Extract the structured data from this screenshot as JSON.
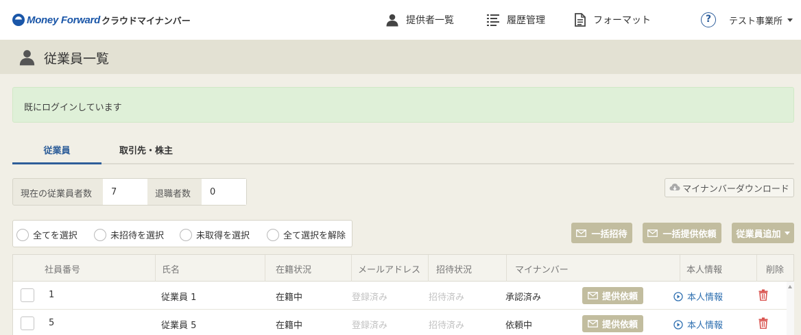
{
  "brand": {
    "name": "Money Forward",
    "product": "クラウドマイナンバー"
  },
  "nav": {
    "providers": "提供者一覧",
    "history": "履歴管理",
    "format": "フォーマット",
    "help": "?",
    "office": "テスト事業所"
  },
  "page": {
    "title": "従業員一覧"
  },
  "alert": {
    "message": "既にログインしています"
  },
  "tabs": [
    {
      "label": "従業員",
      "active": true
    },
    {
      "label": "取引先・株主",
      "active": false
    }
  ],
  "counts": {
    "current_label": "現在の従業員者数",
    "current_value": "7",
    "retired_label": "退職者数",
    "retired_value": "0"
  },
  "download_button": "マイナンバーダウンロード",
  "selection": {
    "select_all": "全てを選択",
    "select_uninvited": "未招待を選択",
    "select_unacquired": "未取得を選択",
    "deselect_all": "全て選択を解除"
  },
  "actions": {
    "bulk_invite": "一括招待",
    "bulk_request": "一括提供依頼",
    "add_employee": "従業員追加"
  },
  "table": {
    "headers": [
      "社員番号",
      "氏名",
      "在籍状況",
      "メールアドレス",
      "招待状況",
      "マイナンバー",
      "本人情報",
      "削除"
    ],
    "rows": [
      {
        "id": "1",
        "name": "従業員 1",
        "status": "在籍中",
        "email": "登録済み",
        "invite": "招待済み",
        "mynumber": "承認済み",
        "request_button": "提供依頼",
        "info_link": "本人情報"
      },
      {
        "id": "5",
        "name": "従業員 5",
        "status": "在籍中",
        "email": "登録済み",
        "invite": "招待済み",
        "mynumber": "依頼中",
        "request_button": "提供依頼",
        "info_link": "本人情報"
      }
    ]
  },
  "colors": {
    "brand_blue": "#1a56a8",
    "accent_blue": "#2e5e99",
    "button_khaki": "#c2bd9f",
    "alert_green": "#dff0d8",
    "delete_red": "#d9534f"
  }
}
